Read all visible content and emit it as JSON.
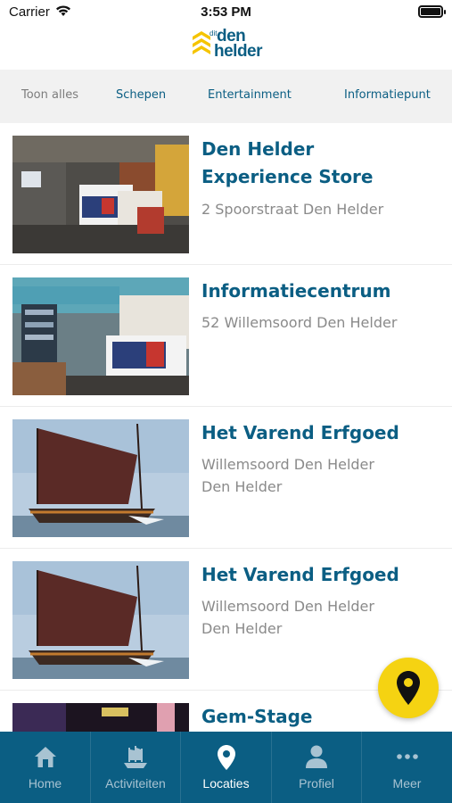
{
  "status_bar": {
    "carrier": "Carrier",
    "time": "3:53 PM"
  },
  "header": {
    "logo": {
      "small": "dit",
      "line1": "den",
      "line2": "helder"
    }
  },
  "filters": {
    "items": [
      {
        "label": "Toon alles",
        "active": false
      },
      {
        "label": "Schepen",
        "active": true
      },
      {
        "label": "Entertainment",
        "active": true
      },
      {
        "label": "Informatiepunt",
        "active": true
      }
    ]
  },
  "locations": [
    {
      "title_line1": "Den Helder",
      "title_line2": "Experience Store",
      "address_line1": "2 Spoorstraat Den Helder",
      "address_line2": ""
    },
    {
      "title_line1": "Informatiecentrum",
      "title_line2": "",
      "address_line1": "52 Willemsoord Den Helder",
      "address_line2": ""
    },
    {
      "title_line1": "Het Varend Erfgoed",
      "title_line2": "",
      "address_line1": "Willemsoord Den Helder",
      "address_line2": "Den Helder"
    },
    {
      "title_line1": "Het Varend Erfgoed",
      "title_line2": "",
      "address_line1": "Willemsoord Den Helder",
      "address_line2": "Den Helder"
    },
    {
      "title_line1": "Gem-Stage",
      "title_line2": "",
      "address_line1": "",
      "address_line2": ""
    }
  ],
  "fab": {
    "icon": "map-pin-icon",
    "color": "#f5d312"
  },
  "tabbar": {
    "items": [
      {
        "label": "Home",
        "icon": "home-icon",
        "active": false
      },
      {
        "label": "Activiteiten",
        "icon": "ship-icon",
        "active": false
      },
      {
        "label": "Locaties",
        "icon": "map-pin-icon",
        "active": true
      },
      {
        "label": "Profiel",
        "icon": "person-icon",
        "active": false
      },
      {
        "label": "Meer",
        "icon": "more-dots-icon",
        "active": false
      }
    ]
  },
  "colors": {
    "primary": "#0b5e83",
    "accent": "#f5d312",
    "muted_text": "#8a8a8a",
    "filter_bg": "#f1f1f1"
  }
}
